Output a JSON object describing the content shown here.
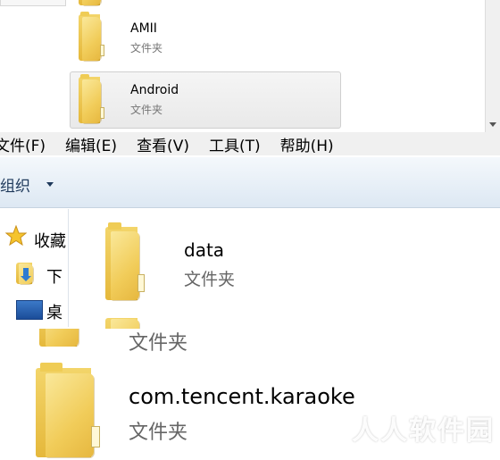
{
  "top_list": {
    "items": [
      {
        "name": "AMII",
        "type": "文件夹"
      },
      {
        "name": "Android",
        "type": "文件夹"
      }
    ]
  },
  "menubar": {
    "items": [
      "文件(F)",
      "编辑(E)",
      "查看(V)",
      "工具(T)",
      "帮助(H)"
    ]
  },
  "toolbar": {
    "organize_label": "组织"
  },
  "nav": {
    "items": [
      {
        "label": "收藏",
        "icon": "star-icon"
      },
      {
        "label": "下",
        "icon": "downloads-icon"
      },
      {
        "label": "桌",
        "icon": "desktop-icon"
      }
    ]
  },
  "content": {
    "items": [
      {
        "name": "data",
        "type": "文件夹"
      },
      {
        "name": "",
        "type": "文件夹"
      },
      {
        "name": "com.tencent.karaoke",
        "type": "文件夹"
      }
    ]
  },
  "watermark": "人人软件园",
  "colors": {
    "menubar_bg": "#f0f0f0",
    "toolbar_text": "#1e395b",
    "folder_yellow": "#f1cc59",
    "selection_bg": "#e9e9e9"
  }
}
